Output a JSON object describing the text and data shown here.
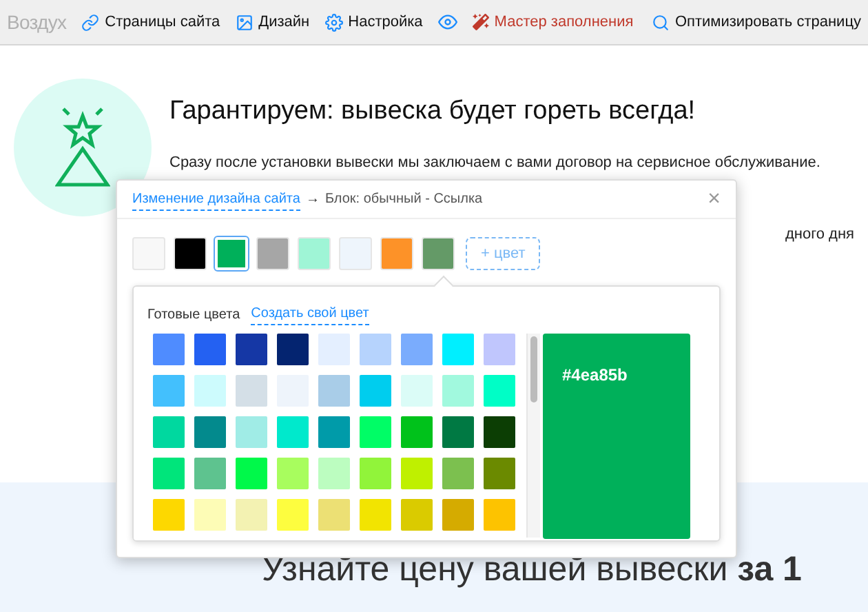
{
  "nav": {
    "logo": "Воздух",
    "items": [
      {
        "kind": "link",
        "label": "Страницы сайта"
      },
      {
        "kind": "image",
        "label": "Дизайн"
      },
      {
        "kind": "gear",
        "label": "Настройка"
      },
      {
        "kind": "eye"
      },
      {
        "kind": "wand",
        "label": "Мастер заполнения"
      }
    ],
    "optimize": "Оптимизировать страницу"
  },
  "hero": {
    "title": "Гарантируем: вывеска будет гореть всегда!",
    "text": "Сразу после установки вывески мы заключаем с вами договор на сервисное обслуживание.",
    "fragment": "дного дня"
  },
  "dialog": {
    "breadcrumb_link": "Изменение дизайна сайта",
    "arrow": "→",
    "breadcrumb": "Блок: обычный - Ссылка",
    "close": "×",
    "swatches": [
      {
        "color": "#f8f8f8",
        "selected": false
      },
      {
        "color": "#000000",
        "selected": false
      },
      {
        "color": "#00b05a",
        "selected": true
      },
      {
        "color": "#a6a6a6",
        "selected": false
      },
      {
        "color": "#9ff5d6",
        "selected": false
      },
      {
        "color": "#eef5fc",
        "selected": false
      },
      {
        "color": "#fd9228",
        "selected": false
      },
      {
        "color": "#649a67",
        "selected": false
      }
    ],
    "add_color": "+ цвет",
    "palette": {
      "tab": "Готовые цвета",
      "create_link": "Создать свой цвет",
      "colors": [
        {
          "color": "#4f8cff"
        },
        {
          "color": "#2461f2"
        },
        {
          "color": "#1537a5"
        },
        {
          "color": "#042470"
        },
        {
          "color": "#e4efff"
        },
        {
          "color": "#b6d3fd"
        },
        {
          "color": "#7aacfd"
        },
        {
          "color": "#00efff"
        },
        {
          "color": "#c0c6fd"
        },
        {
          "color": "#43c0fd"
        },
        {
          "color": "#cdfbfd"
        },
        {
          "color": "#d4dfe7"
        },
        {
          "color": "#eef4fb"
        },
        {
          "color": "#a9cde8"
        },
        {
          "color": "#00cdee"
        },
        {
          "color": "#dbfcf7"
        },
        {
          "color": "#a1f9de"
        },
        {
          "color": "#00fec6"
        },
        {
          "color": "#00d89f"
        },
        {
          "color": "#038a8d"
        },
        {
          "color": "#a0ece6"
        },
        {
          "color": "#00e9cc"
        },
        {
          "color": "#009ba9"
        },
        {
          "color": "#00fd66"
        },
        {
          "color": "#00c21b"
        },
        {
          "color": "#007943"
        },
        {
          "color": "#0c3e04"
        },
        {
          "color": "#00e57b"
        },
        {
          "color": "#5ec38f"
        },
        {
          "color": "#00f94a"
        },
        {
          "color": "#a8fd5e"
        },
        {
          "color": "#bcfdc0"
        },
        {
          "color": "#91f43a"
        },
        {
          "color": "#bff000"
        },
        {
          "color": "#7cc04f"
        },
        {
          "color": "#6b8a00"
        },
        {
          "color": "#fdd800"
        },
        {
          "color": "#fdfcb6"
        },
        {
          "color": "#f3f2b2"
        },
        {
          "color": "#fdfd3f"
        },
        {
          "color": "#ece074"
        },
        {
          "color": "#f2e401"
        },
        {
          "color": "#dacb00"
        },
        {
          "color": "#d5ab00"
        },
        {
          "color": "#fdc300"
        }
      ],
      "preview": {
        "color": "#00b05a",
        "hex": "#4ea85b"
      }
    }
  },
  "cta": "Узнайте цену вашей вывески **за 1**"
}
